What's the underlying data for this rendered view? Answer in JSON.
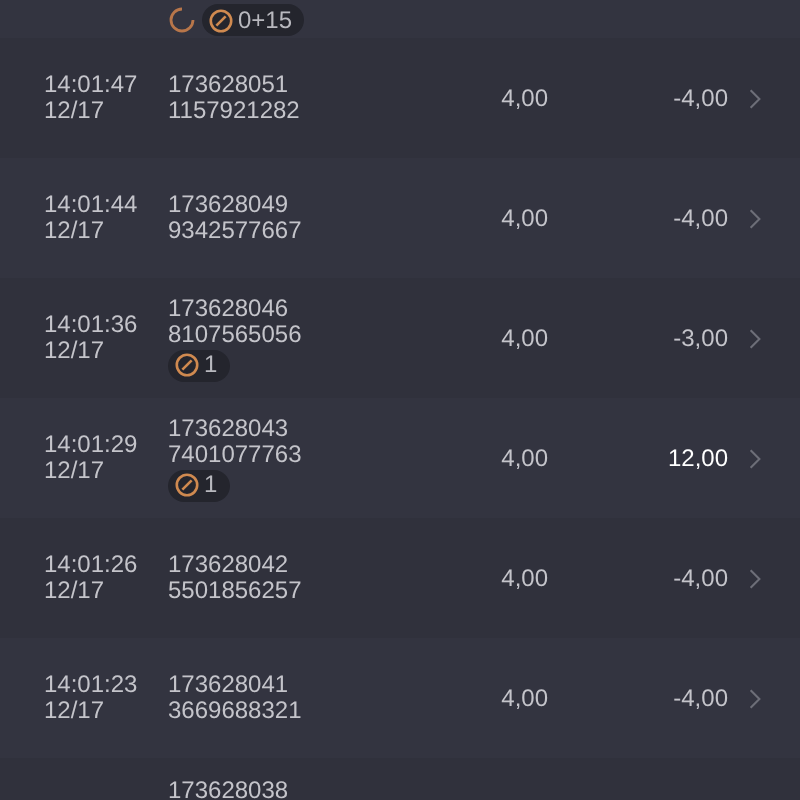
{
  "top_row": {
    "badges": [
      {
        "kind": "spinner"
      },
      {
        "kind": "bonus",
        "text": "0+15"
      }
    ]
  },
  "rows": [
    {
      "time": "14:01:47",
      "date": "12/17",
      "ticket": "173628051",
      "code": "1157921282",
      "stake": "4,00",
      "result": "-4,00",
      "win": false,
      "badges": []
    },
    {
      "time": "14:01:44",
      "date": "12/17",
      "ticket": "173628049",
      "code": "9342577667",
      "stake": "4,00",
      "result": "-4,00",
      "win": false,
      "badges": []
    },
    {
      "time": "14:01:36",
      "date": "12/17",
      "ticket": "173628046",
      "code": "8107565056",
      "stake": "4,00",
      "result": "-3,00",
      "win": false,
      "badges": [
        {
          "kind": "bonus",
          "text": "1"
        }
      ]
    },
    {
      "time": "14:01:29",
      "date": "12/17",
      "ticket": "173628043",
      "code": "7401077763",
      "stake": "4,00",
      "result": "12,00",
      "win": true,
      "badges": [
        {
          "kind": "bonus",
          "text": "1"
        }
      ]
    },
    {
      "time": "14:01:26",
      "date": "12/17",
      "ticket": "173628042",
      "code": "5501856257",
      "stake": "4,00",
      "result": "-4,00",
      "win": false,
      "badges": []
    },
    {
      "time": "14:01:23",
      "date": "12/17",
      "ticket": "173628041",
      "code": "3669688321",
      "stake": "4,00",
      "result": "-4,00",
      "win": false,
      "badges": []
    }
  ],
  "bottom_row": {
    "ticket": "173628038"
  }
}
